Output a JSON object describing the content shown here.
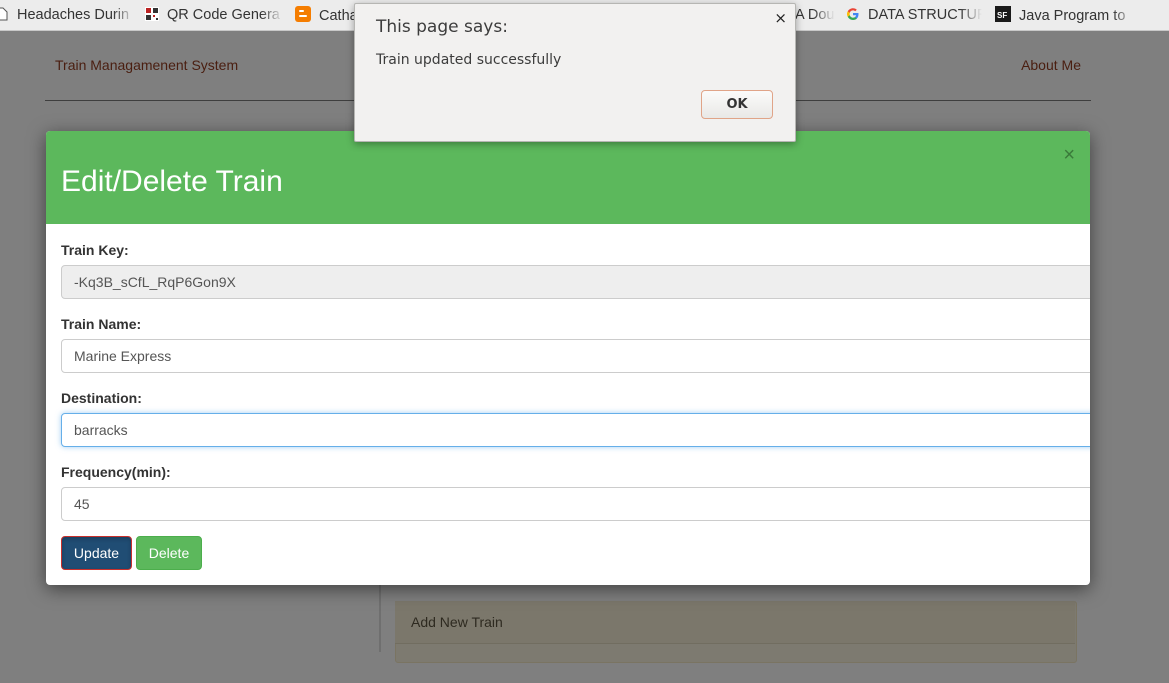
{
  "bookmarks": [
    {
      "label": "Headaches Durin",
      "icon": "document-icon"
    },
    {
      "label": "QR Code Genera",
      "icon": "qr-code-icon"
    },
    {
      "label": "Catha",
      "icon": "blogger-icon"
    },
    {
      "label": "A Dou",
      "icon": "partial-bookmark-icon"
    },
    {
      "label": "DATA STRUCTURE",
      "icon": "google-icon"
    },
    {
      "label": "Java Program to",
      "icon": "sf-icon"
    }
  ],
  "navbar": {
    "brand": "Train Managamenent System",
    "about": "About Me"
  },
  "background": {
    "panel_title": "Add New Train"
  },
  "modal": {
    "title": "Edit/Delete Train",
    "close": "×",
    "fields": {
      "key": {
        "label": "Train Key:",
        "value": "-Kq3B_sCfL_RqP6Gon9X"
      },
      "name": {
        "label": "Train Name:",
        "value": "Marine Express"
      },
      "destination": {
        "label": "Destination:",
        "value": "barracks"
      },
      "frequency": {
        "label": "Frequency(min):",
        "value": "45"
      }
    },
    "update_label": "Update",
    "delete_label": "Delete"
  },
  "alert": {
    "title": "This page says:",
    "message": "Train updated successfully",
    "ok": "OK",
    "close": "×"
  },
  "colors": {
    "modal_header": "#5cb85c",
    "update_button": "#204d74",
    "delete_button": "#5cb85c",
    "focus_border": "#66afe9"
  }
}
